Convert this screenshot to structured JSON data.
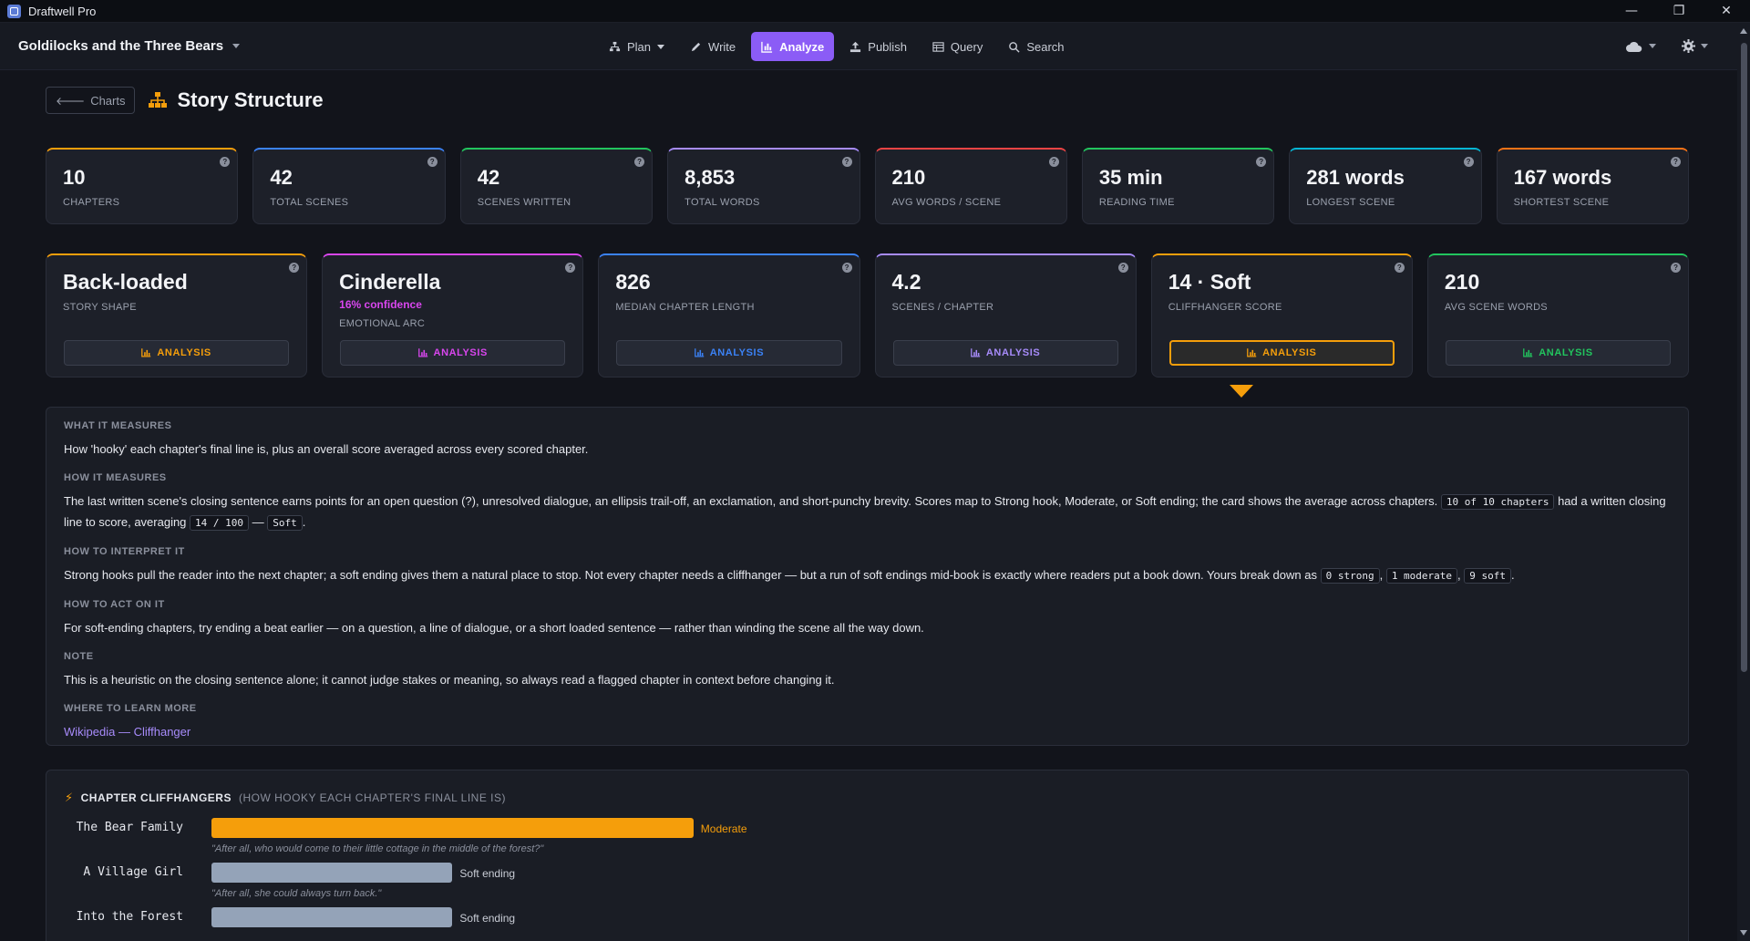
{
  "window": {
    "title": "Draftwell Pro"
  },
  "header": {
    "project": "Goldilocks and the Three Bears",
    "nav": [
      {
        "label": "Plan",
        "icon": "sitemap-icon",
        "dropdown": true
      },
      {
        "label": "Write",
        "icon": "pencil-icon"
      },
      {
        "label": "Analyze",
        "icon": "chart-icon",
        "active": true
      },
      {
        "label": "Publish",
        "icon": "upload-icon"
      },
      {
        "label": "Query",
        "icon": "table-icon"
      },
      {
        "label": "Search",
        "icon": "search-icon"
      }
    ]
  },
  "page": {
    "back_label": "Charts",
    "title": "Story Structure"
  },
  "stats": [
    {
      "value": "10",
      "label": "CHAPTERS",
      "color": "#f59e0b"
    },
    {
      "value": "42",
      "label": "TOTAL SCENES",
      "color": "#3b82f6"
    },
    {
      "value": "42",
      "label": "SCENES WRITTEN",
      "color": "#22c55e"
    },
    {
      "value": "8,853",
      "label": "TOTAL WORDS",
      "color": "#a78bfa"
    },
    {
      "value": "210",
      "label": "AVG WORDS / SCENE",
      "color": "#ef4444"
    },
    {
      "value": "35 min",
      "label": "READING TIME",
      "color": "#22c55e"
    },
    {
      "value": "281 words",
      "label": "LONGEST SCENE",
      "color": "#06b6d4"
    },
    {
      "value": "167 words",
      "label": "SHORTEST SCENE",
      "color": "#f97316"
    }
  ],
  "cards": [
    {
      "value": "Back-loaded",
      "label": "STORY SHAPE",
      "color": "#f59e0b",
      "button": "ANALYSIS"
    },
    {
      "value": "Cinderella",
      "confidence": "16% confidence",
      "label": "EMOTIONAL ARC",
      "color": "#d946ef",
      "button": "ANALYSIS"
    },
    {
      "value": "826",
      "label": "MEDIAN CHAPTER LENGTH",
      "color": "#3b82f6",
      "button": "ANALYSIS"
    },
    {
      "value": "4.2",
      "label": "SCENES / CHAPTER",
      "color": "#a78bfa",
      "button": "ANALYSIS"
    },
    {
      "value": "14 · Soft",
      "label": "CLIFFHANGER SCORE",
      "color": "#f59e0b",
      "button": "ANALYSIS",
      "focused": true
    },
    {
      "value": "210",
      "label": "AVG SCENE WORDS",
      "color": "#22c55e",
      "button": "ANALYSIS"
    }
  ],
  "info": {
    "what_h": "WHAT IT MEASURES",
    "what_p": "How 'hooky' each chapter's final line is, plus an overall score averaged across every scored chapter.",
    "how_h": "HOW IT MEASURES",
    "how_p1": "The last written scene's closing sentence earns points for an open question (?), unresolved dialogue, an ellipsis trail-off, an exclamation, and short-punchy brevity. Scores map to Strong hook, Moderate, or Soft ending; the card shows the average across chapters.",
    "how_c1": "10 of 10 chapters",
    "how_p2": "had a written closing line to score, averaging",
    "how_c2": "14 / 100",
    "how_dash": "—",
    "how_c3": "Soft",
    "interp_h": "HOW TO INTERPRET IT",
    "interp_p": "Strong hooks pull the reader into the next chapter; a soft ending gives them a natural place to stop. Not every chapter needs a cliffhanger — but a run of soft endings mid-book is exactly where readers put a book down. Yours break down as",
    "interp_c1": "0 strong",
    "interp_c2": "1 moderate",
    "interp_c3": "9 soft",
    "act_h": "HOW TO ACT ON IT",
    "act_p": "For soft-ending chapters, try ending a beat earlier — on a question, a line of dialogue, or a short loaded sentence — rather than winding the scene all the way down.",
    "note_h": "NOTE",
    "note_p": "This is a heuristic on the closing sentence alone; it cannot judge stakes or meaning, so always read a flagged chapter in context before changing it.",
    "learn_h": "WHERE TO LEARN MORE",
    "learn_link": "Wikipedia — Cliffhanger"
  },
  "cliffhangers": {
    "title": "CHAPTER CLIFFHANGERS",
    "subtitle": "(HOW HOOKY EACH CHAPTER'S FINAL LINE IS)",
    "chart_data": {
      "type": "bar",
      "categories": [
        "The Bear Family",
        "A Village Girl",
        "Into the Forest"
      ],
      "values": [
        40,
        20,
        20
      ],
      "ratings": [
        "Moderate",
        "Soft ending",
        "Soft ending"
      ],
      "quotes": [
        "\"After all, who would come to their little cottage in the middle of the forest?\"",
        "\"After all, she could always turn back.\"",
        ""
      ],
      "colors": {
        "Moderate": "#f59e0b",
        "Soft ending": "#94a3b8"
      },
      "xlim": [
        0,
        100
      ]
    }
  }
}
